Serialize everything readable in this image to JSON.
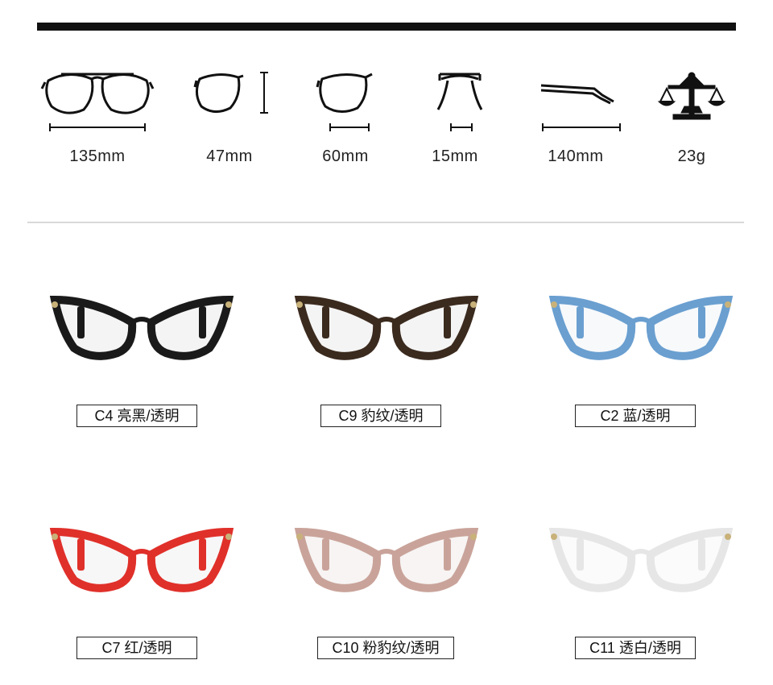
{
  "specs": [
    {
      "name": "frame-width",
      "value": "135mm"
    },
    {
      "name": "lens-height",
      "value": "47mm"
    },
    {
      "name": "lens-width",
      "value": "60mm"
    },
    {
      "name": "bridge-width",
      "value": "15mm"
    },
    {
      "name": "temple-length",
      "value": "140mm"
    },
    {
      "name": "weight",
      "value": "23g"
    }
  ],
  "products": [
    {
      "label": "C4 亮黑/透明",
      "frame_color": "#1a1a1a",
      "lens_color": "#f4f4f4"
    },
    {
      "label": "C9 豹纹/透明",
      "frame_color": "#3b2a1e",
      "lens_color": "#f4f4f4"
    },
    {
      "label": "C2 蓝/透明",
      "frame_color": "#6a9fd0",
      "lens_color": "#f7f9fb"
    },
    {
      "label": "C7 红/透明",
      "frame_color": "#e0302a",
      "lens_color": "#f7f7f7"
    },
    {
      "label": "C10 粉豹纹/透明",
      "frame_color": "#c9a39a",
      "lens_color": "#f7f4f3"
    },
    {
      "label": "C11 透白/透明",
      "frame_color": "#e6e6e6",
      "lens_color": "#fbfbfb"
    }
  ]
}
